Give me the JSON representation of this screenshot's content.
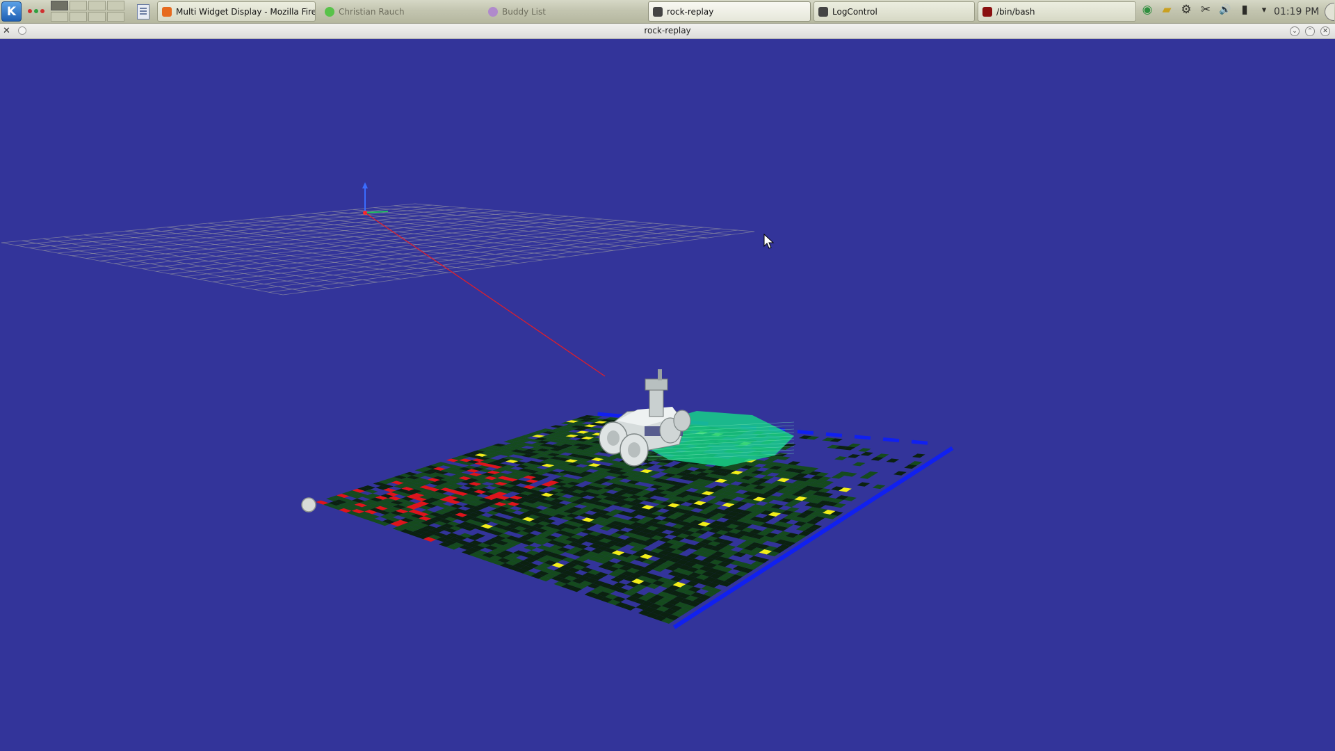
{
  "panel": {
    "kmenu_glyph": "K",
    "tasks": [
      {
        "label": "Multi Widget Display - Mozilla Firefox",
        "icon": "firefox-icon",
        "color": "#e66a1e",
        "state": "raised"
      },
      {
        "label": "Christian Rauch",
        "icon": "chat-status-icon",
        "color": "#58c24a",
        "state": "dim"
      },
      {
        "label": "Buddy List",
        "icon": "pidgin-icon",
        "color": "#b08acc",
        "state": "dim"
      },
      {
        "label": "rock-replay",
        "icon": "rock-icon",
        "color": "#444444",
        "state": "active"
      },
      {
        "label": "LogControl",
        "icon": "rock-icon",
        "color": "#444444",
        "state": "raised"
      },
      {
        "label": "/bin/bash",
        "icon": "terminal-icon",
        "color": "#8a1010",
        "state": "raised"
      }
    ],
    "tray_icons": [
      {
        "name": "network-icon",
        "glyph": "◉"
      },
      {
        "name": "folder-icon",
        "glyph": "▰"
      },
      {
        "name": "settings-icon",
        "glyph": "⚙"
      },
      {
        "name": "klipper-icon",
        "glyph": "✂"
      },
      {
        "name": "volume-icon",
        "glyph": "🔊"
      },
      {
        "name": "battery-icon",
        "glyph": "▮"
      },
      {
        "name": "tray-expand-icon",
        "glyph": "▾"
      }
    ],
    "clock": "01:19 PM"
  },
  "window": {
    "title": "rock-replay",
    "menu_glyph": "✕",
    "buttons": [
      "⌄",
      "⌃",
      "✕"
    ]
  },
  "scene": {
    "background": "#33349a",
    "colors": {
      "grid": "#8f8fa0",
      "axis_red": "#ff2a2a",
      "axis_green": "#20c060",
      "axis_blue": "#3a6cff",
      "trajectory": "#e01e2a",
      "cell_dark": "#0b2110",
      "cell_mid": "#154a1d",
      "cell_red": "#e0141a",
      "cell_yellow": "#f2ee18",
      "boundary_blue": "#1020f0",
      "scan_green": "#18d08a",
      "robot_body": "#d6dcdc"
    }
  }
}
